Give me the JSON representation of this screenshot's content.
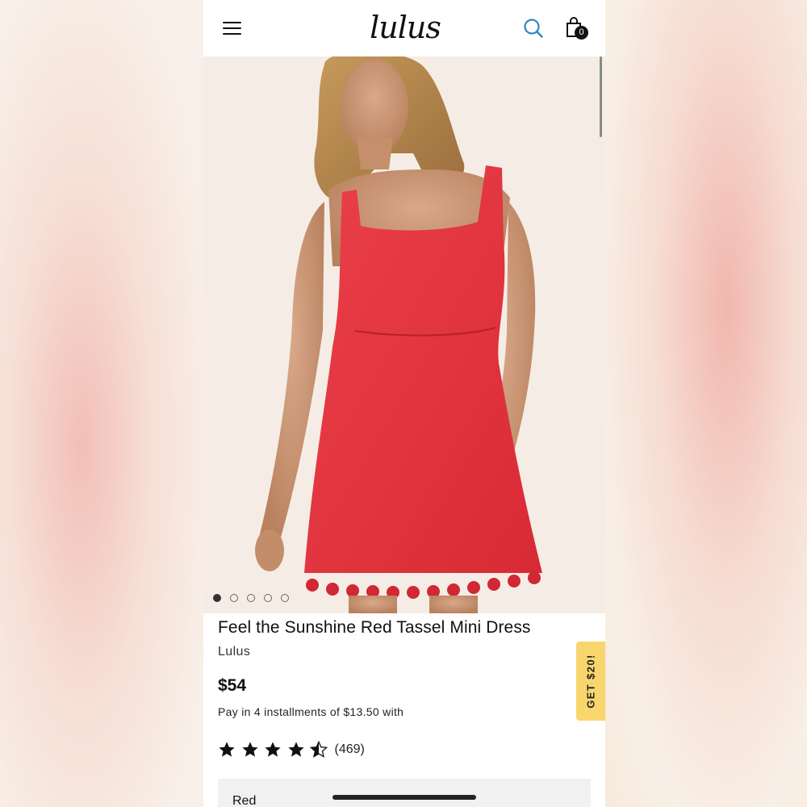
{
  "header": {
    "logo_text": "lulus",
    "cart_count": "0",
    "icons": {
      "menu": "hamburger-menu-icon",
      "search": "search-icon",
      "cart": "shopping-bag-icon"
    }
  },
  "gallery": {
    "image_description": "model-in-red-dress-photo",
    "dots": [
      true,
      false,
      false,
      false,
      false
    ]
  },
  "product": {
    "title": "Feel the Sunshine Red Tassel Mini Dress",
    "brand": "Lulus",
    "price": "$54",
    "installments": "Pay in 4 installments of $13.50 with",
    "rating_value": 4.5,
    "rating_max": 5,
    "review_count": "(469)",
    "color_label": "Red"
  },
  "promo": {
    "label": "GET $20!"
  },
  "colors": {
    "accent_search": "#2e86c1",
    "promo_bg": "#f9d56e",
    "dress_red": "#e2353f"
  }
}
